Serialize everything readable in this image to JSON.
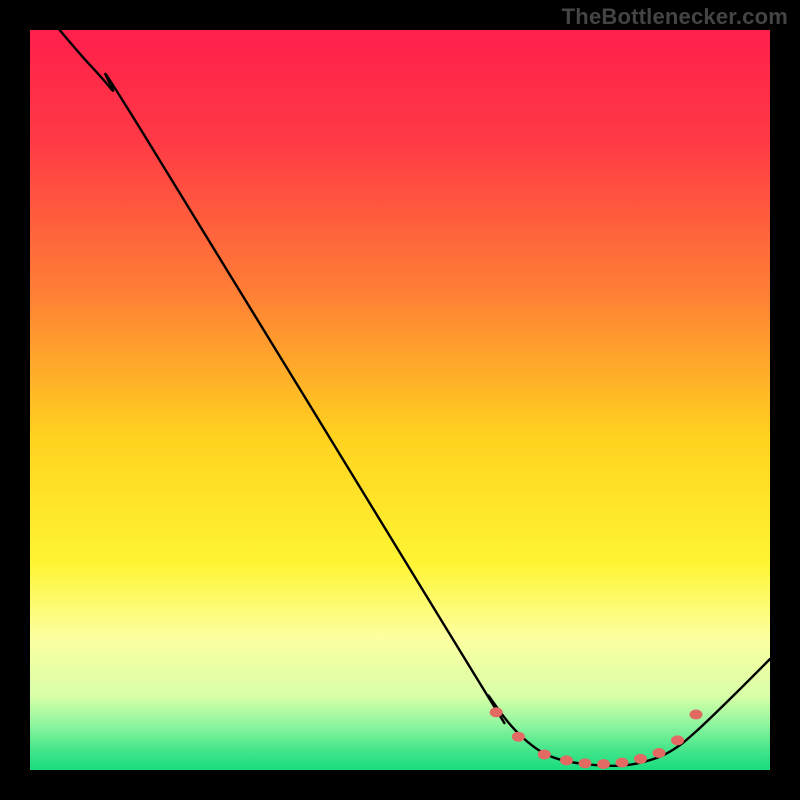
{
  "watermark": "TheBottlenecker.com",
  "chart_data": {
    "type": "line",
    "x_range": [
      0,
      100
    ],
    "y_range": [
      0,
      100
    ],
    "gradient_stops": [
      {
        "offset": 0.0,
        "color": "#ff1f4c"
      },
      {
        "offset": 0.15,
        "color": "#ff3a45"
      },
      {
        "offset": 0.35,
        "color": "#ff7d36"
      },
      {
        "offset": 0.55,
        "color": "#ffd21f"
      },
      {
        "offset": 0.72,
        "color": "#fff534"
      },
      {
        "offset": 0.82,
        "color": "#fdffa0"
      },
      {
        "offset": 0.9,
        "color": "#d8ffa8"
      },
      {
        "offset": 0.94,
        "color": "#8cf59e"
      },
      {
        "offset": 0.97,
        "color": "#4ae68c"
      },
      {
        "offset": 1.0,
        "color": "#18dc7e"
      }
    ],
    "series": [
      {
        "name": "bottleneck-curve",
        "color": "#000000",
        "width": 2.4,
        "points": [
          {
            "x": 4.0,
            "y": 100.0
          },
          {
            "x": 7.0,
            "y": 96.5
          },
          {
            "x": 11.0,
            "y": 92.0
          },
          {
            "x": 15.0,
            "y": 86.5
          },
          {
            "x": 60.0,
            "y": 13.0
          },
          {
            "x": 62.0,
            "y": 10.0
          },
          {
            "x": 65.0,
            "y": 6.0
          },
          {
            "x": 68.0,
            "y": 3.2
          },
          {
            "x": 71.0,
            "y": 1.6
          },
          {
            "x": 75.0,
            "y": 0.8
          },
          {
            "x": 80.0,
            "y": 0.6
          },
          {
            "x": 84.0,
            "y": 1.4
          },
          {
            "x": 87.0,
            "y": 2.8
          },
          {
            "x": 90.0,
            "y": 5.2
          },
          {
            "x": 95.0,
            "y": 10.0
          },
          {
            "x": 100.0,
            "y": 15.0
          }
        ]
      }
    ],
    "markers": {
      "color": "#e26a63",
      "rx": 6.5,
      "ry": 5,
      "points": [
        {
          "x": 63.0,
          "y": 7.8
        },
        {
          "x": 66.0,
          "y": 4.5
        },
        {
          "x": 69.5,
          "y": 2.1
        },
        {
          "x": 72.5,
          "y": 1.3
        },
        {
          "x": 75.0,
          "y": 0.9
        },
        {
          "x": 77.5,
          "y": 0.8
        },
        {
          "x": 80.0,
          "y": 1.0
        },
        {
          "x": 82.5,
          "y": 1.5
        },
        {
          "x": 85.0,
          "y": 2.3
        },
        {
          "x": 87.5,
          "y": 4.0
        },
        {
          "x": 90.0,
          "y": 7.5
        }
      ]
    }
  }
}
